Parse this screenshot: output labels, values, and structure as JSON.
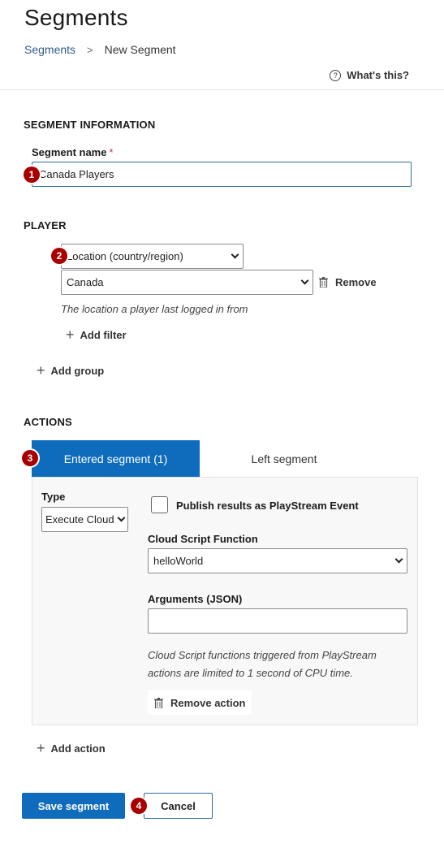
{
  "header": {
    "title": "Segments",
    "breadcrumb": {
      "root": "Segments",
      "separator": ">",
      "current": "New Segment"
    },
    "help_link": "What's this?",
    "help_icon_glyph": "?"
  },
  "segment_info": {
    "section_title": "SEGMENT INFORMATION",
    "name_label": "Segment name",
    "required_marker": "*",
    "name_value": "Canada Players"
  },
  "player": {
    "section_title": "PLAYER",
    "filter_type": "Location (country/region)",
    "filter_value": "Canada",
    "remove_label": "Remove",
    "helper_text": "The location a player last logged in from",
    "add_filter_label": "Add filter",
    "add_group_label": "Add group"
  },
  "actions": {
    "section_title": "ACTIONS",
    "tabs": [
      {
        "label": "Entered segment (1)",
        "active": true
      },
      {
        "label": "Left segment",
        "active": false
      }
    ],
    "type_label": "Type",
    "type_value": "Execute Cloud Script",
    "publish_label": "Publish results as PlayStream Event",
    "publish_checked": false,
    "function_label": "Cloud Script Function",
    "function_value": "helloWorld",
    "arguments_label": "Arguments (JSON)",
    "arguments_value": "",
    "cpu_note": "Cloud Script functions triggered from PlayStream actions are limited to 1 second of CPU time.",
    "remove_action_label": "Remove action",
    "add_action_label": "Add action"
  },
  "footer": {
    "save_label": "Save segment",
    "cancel_label": "Cancel"
  },
  "badges": [
    "1",
    "2",
    "3",
    "4"
  ],
  "colors": {
    "primary": "#0f6cbd",
    "badge": "#a80000",
    "link": "#2e5c8a",
    "required": "#c4314b"
  },
  "icons": {
    "plus": "+",
    "help": "question-circle-icon",
    "trash": "trash-icon",
    "chevron": "chevron-down-icon",
    "breadcrumb_separator": "chevron-right-icon"
  }
}
